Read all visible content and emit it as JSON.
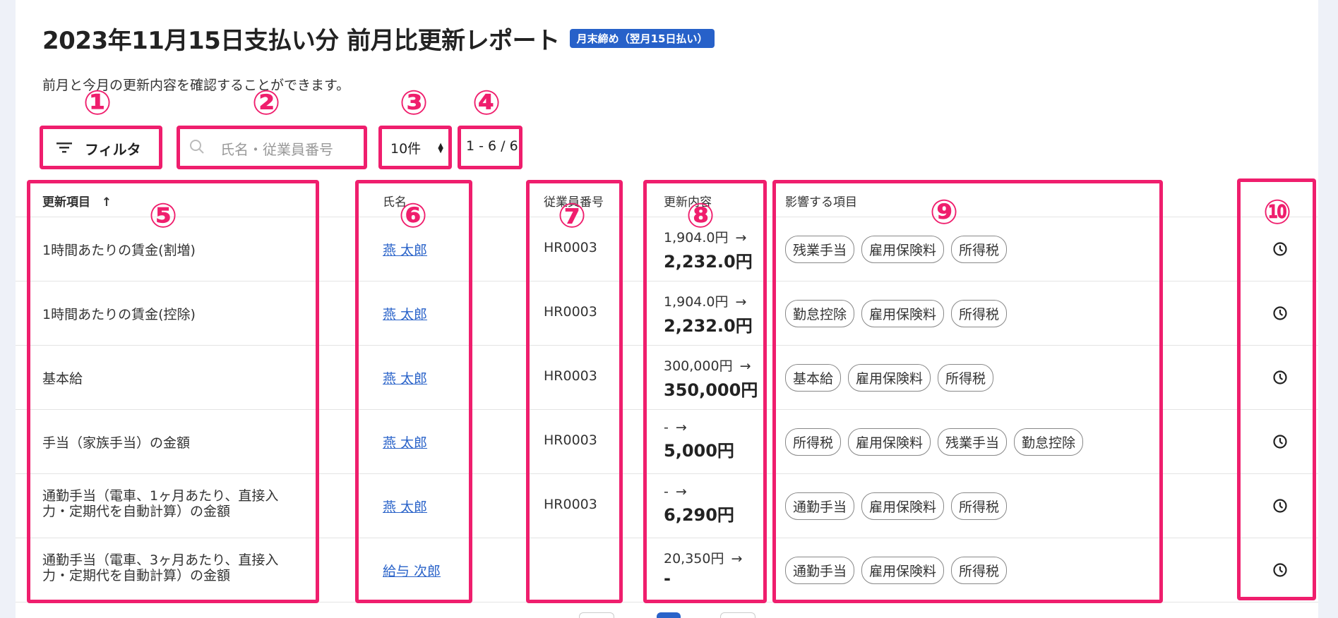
{
  "header": {
    "title": "2023年11月15日支払い分 前月比更新レポート",
    "badge": "月末締め（翌月15日払い）",
    "subtitle": "前月と今月の更新内容を確認することができます。"
  },
  "toolbar": {
    "filter_label": "フィルタ",
    "search_placeholder": "氏名・従業員番号",
    "per_page": "10件",
    "pagination": "1 - 6 / 6"
  },
  "table": {
    "columns": [
      "更新項目",
      "氏名",
      "従業員番号",
      "更新内容",
      "影響する項目"
    ],
    "sort_indicator": "↑",
    "rows": [
      {
        "item": "1時間あたりの賃金(割増)",
        "name": "燕 太郎",
        "emp_no": "HR0003",
        "old": "1,904.0円",
        "arrow": "→",
        "new": "2,232.0円",
        "tags": [
          "残業手当",
          "雇用保険料",
          "所得税"
        ]
      },
      {
        "item": "1時間あたりの賃金(控除)",
        "name": "燕 太郎",
        "emp_no": "HR0003",
        "old": "1,904.0円",
        "arrow": "→",
        "new": "2,232.0円",
        "tags": [
          "勤怠控除",
          "雇用保険料",
          "所得税"
        ]
      },
      {
        "item": "基本給",
        "name": "燕 太郎",
        "emp_no": "HR0003",
        "old": "300,000円",
        "arrow": "→",
        "new": "350,000円",
        "tags": [
          "基本給",
          "雇用保険料",
          "所得税"
        ]
      },
      {
        "item": "手当（家族手当）の金額",
        "name": "燕 太郎",
        "emp_no": "HR0003",
        "old": "-",
        "arrow": "→",
        "new": "5,000円",
        "tags": [
          "所得税",
          "雇用保険料",
          "残業手当",
          "勤怠控除"
        ]
      },
      {
        "item": "通勤手当（電車、1ヶ月あたり、直接入力・定期代を自動計算）の金額",
        "item_line1": "通勤手当（電車、1ヶ月あたり、直接入",
        "item_line2": "力・定期代を自動計算）の金額",
        "name": "燕 太郎",
        "emp_no": "HR0003",
        "old": "-",
        "arrow": "→",
        "new": "6,290円",
        "tags": [
          "通勤手当",
          "雇用保険料",
          "所得税"
        ]
      },
      {
        "item": "通勤手当（電車、3ヶ月あたり、直接入力・定期代を自動計算）の金額",
        "item_line1": "通勤手当（電車、3ヶ月あたり、直接入",
        "item_line2": "力・定期代を自動計算）の金額",
        "name": "給与 次郎",
        "emp_no": "",
        "old": "20,350円",
        "arrow": "→",
        "new": "-",
        "tags": [
          "通勤手当",
          "雇用保険料",
          "所得税"
        ]
      }
    ]
  },
  "annotations": [
    "①",
    "②",
    "③",
    "④",
    "⑤",
    "⑥",
    "⑦",
    "⑧",
    "⑨",
    "⑩"
  ],
  "colors": {
    "annotation": "#ef1e6d",
    "badge": "#2761c9",
    "link": "#2a63c9"
  }
}
